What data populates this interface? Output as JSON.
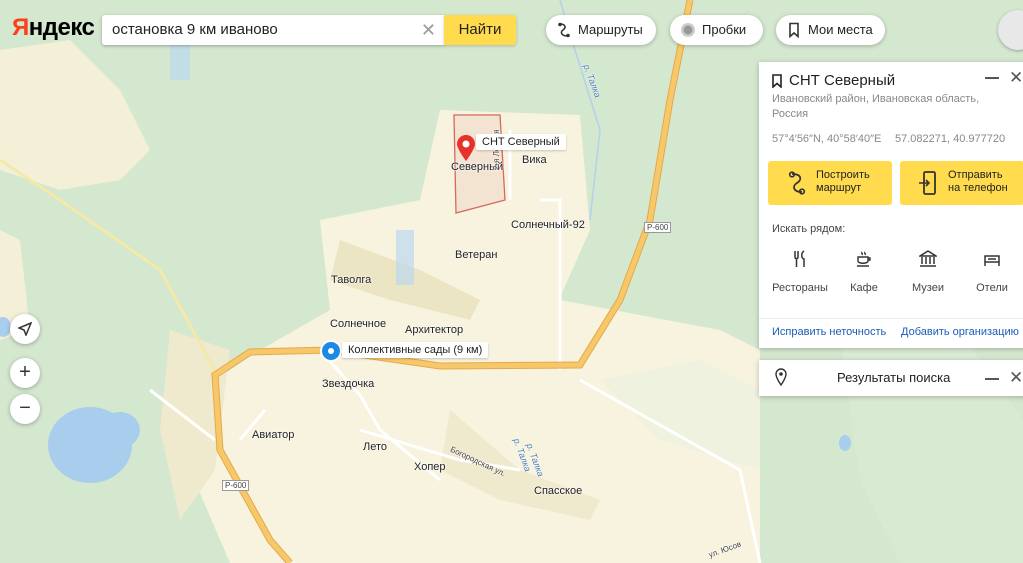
{
  "header": {
    "logo": "Яндекс",
    "search_value": "остановка 9 км иваново",
    "find_label": "Найти",
    "routes_label": "Маршруты",
    "traffic_label": "Пробки",
    "places_label": "Мои места"
  },
  "card": {
    "title": "СНТ Северный",
    "address": "Ивановский район, Ивановская область, Россия",
    "coords_dms": "57°4′56″N, 40°58′40″E",
    "coords_decimal": "57.082271, 40.977720",
    "route_label_1": "Построить",
    "route_label_2": "маршрут",
    "send_label_1": "Отправить",
    "send_label_2": "на телефон",
    "nearby_label": "Искать рядом:",
    "nearby": [
      {
        "label": "Рестораны",
        "icon": "fork-knife-icon"
      },
      {
        "label": "Кафе",
        "icon": "coffee-cup-icon"
      },
      {
        "label": "Музеи",
        "icon": "museum-icon"
      },
      {
        "label": "Отели",
        "icon": "bed-icon"
      }
    ],
    "fix_link": "Исправить неточность",
    "add_org_link": "Добавить организацию"
  },
  "results": {
    "label": "Результаты поиска"
  },
  "map": {
    "marker_label": "СНТ Северный",
    "stop_label": "Коллективные сады (9 км)",
    "places": {
      "severny": "Северный",
      "vika": "Вика",
      "solnechny92": "Солнечный-92",
      "veteran": "Ветеран",
      "tavolga": "Таволга",
      "solnechnoe": "Солнечное",
      "arkhitektor": "Архитектор",
      "zvezdochka": "Звездочка",
      "aviator": "Авиатор",
      "leto": "Лето",
      "khoper": "Хопер",
      "spasskoe": "Спасское"
    },
    "streets": {
      "lesnaya": "2-я Лесная",
      "bogorodskaya": "Богородская ул.",
      "yuzh": "ул. Юсов",
      "r600a": "Р-600",
      "r600b": "Р-600",
      "talka1": "р. Талка",
      "talka2": "р. Талка",
      "talka3": "р. Талка"
    }
  },
  "colors": {
    "forest": "#d4e7cf",
    "field": "#f7f3df",
    "highway": "#f5bc5c",
    "water": "#a9cdec",
    "accent_yellow": "#ffdb4d",
    "marker_red": "#e6322a",
    "stop_blue": "#1e88e5"
  }
}
